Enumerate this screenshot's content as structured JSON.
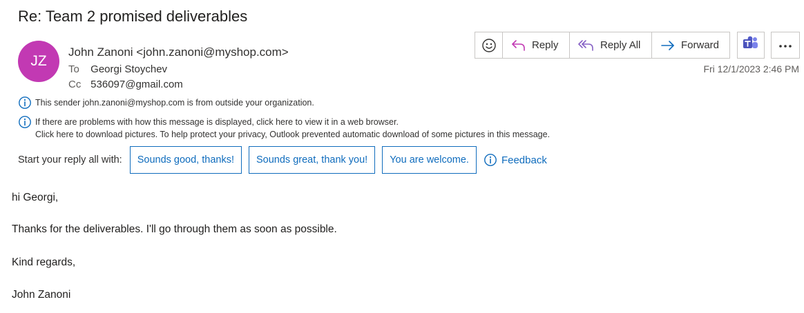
{
  "subject": "Re: Team 2 promised deliverables",
  "sender": {
    "initials": "JZ",
    "display": "John Zanoni <john.zanoni@myshop.com>",
    "avatar_color": "#c239b3"
  },
  "recipients": {
    "to_label": "To",
    "to_value": "Georgi Stoychev",
    "cc_label": "Cc",
    "cc_value": "536097@gmail.com"
  },
  "actions": {
    "emoji_icon": "smiley-icon",
    "reply_label": "Reply",
    "reply_all_label": "Reply All",
    "forward_label": "Forward",
    "teams_icon": "teams-icon",
    "more_icon": "more-icon"
  },
  "date": "Fri 12/1/2023 2:46 PM",
  "notices": {
    "external": "This sender john.zanoni@myshop.com is from outside your organization.",
    "display_problem": "If there are problems with how this message is displayed, click here to view it in a web browser.",
    "pictures": "Click here to download pictures. To help protect your privacy, Outlook prevented automatic download of some pictures in this message."
  },
  "quick_reply": {
    "lead": "Start your reply all with:",
    "suggestions": [
      "Sounds good, thanks!",
      "Sounds great, thank you!",
      "You are welcome."
    ],
    "feedback_label": "Feedback"
  },
  "body": {
    "greeting": "hi Georgi,",
    "line": "Thanks for the deliverables. I'll go through them as soon as possible.",
    "closing": "Kind regards,",
    "signature": "John Zanoni"
  },
  "colors": {
    "accent": "#0f6cbd",
    "reply_all_icon": "#8661c5",
    "teams": "#5059c9"
  }
}
